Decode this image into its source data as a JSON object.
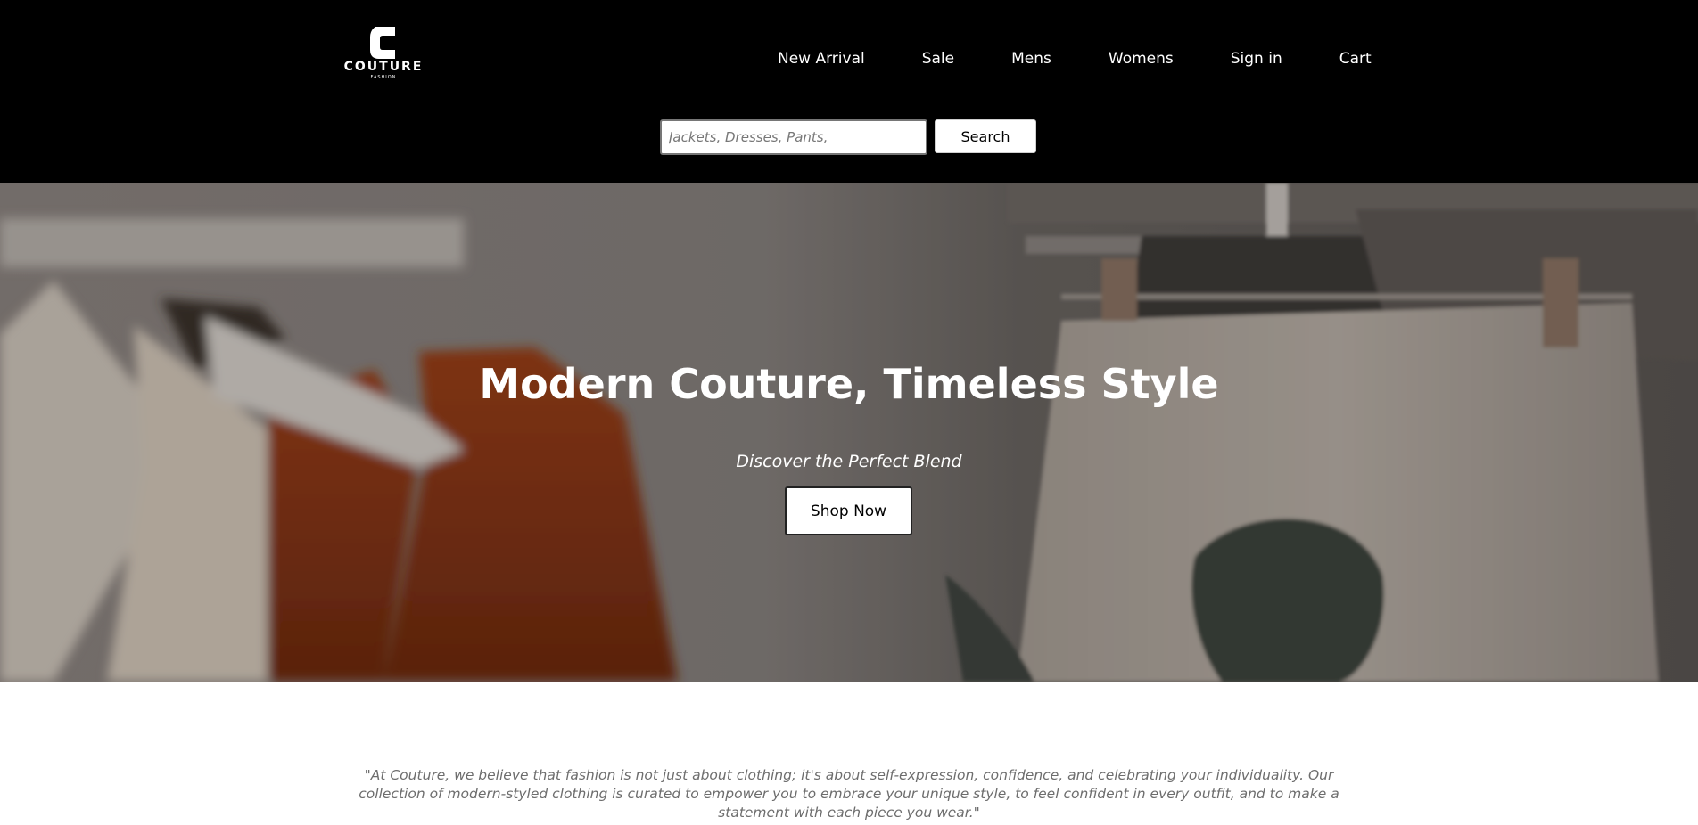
{
  "brand": {
    "name": "COUTURE",
    "tagline": "FASHION",
    "logo_icon": "c-logo-icon"
  },
  "nav": {
    "items": [
      {
        "label": "New Arrival"
      },
      {
        "label": "Sale"
      },
      {
        "label": "Mens"
      },
      {
        "label": "Womens"
      },
      {
        "label": "Sign in"
      },
      {
        "label": "Cart"
      }
    ]
  },
  "search": {
    "placeholder": "Jackets, Dresses, Pants,",
    "value": "",
    "button_label": "Search"
  },
  "hero": {
    "title": "Modern Couture, Timeless Style",
    "subtitle": "Discover the Perfect Blend",
    "cta_label": "Shop Now"
  },
  "intro": {
    "quote": "\"At Couture, we believe that fashion is not just about clothing; it's about self-expression, confidence, and celebrating your individuality. Our collection of modern-styled clothing is curated to empower you to embrace your unique style, to feel confident in every outfit, and to make a statement with each piece you wear.\""
  },
  "colors": {
    "header_bg": "#000000",
    "text_on_dark": "#ffffff",
    "quote_text": "#6d6d6d",
    "accent_rust": "#8a3a18"
  }
}
